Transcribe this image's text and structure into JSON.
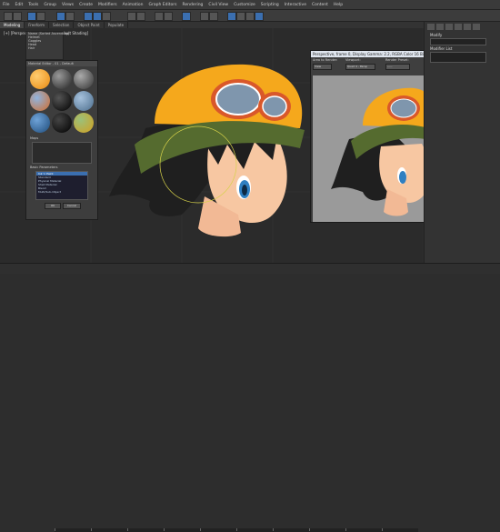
{
  "menubar": {
    "items": [
      "File",
      "Edit",
      "Tools",
      "Group",
      "Views",
      "Create",
      "Modifiers",
      "Animation",
      "Graph Editors",
      "Rendering",
      "Civil View",
      "Customize",
      "Scripting",
      "Interactive",
      "Content",
      "Help"
    ]
  },
  "tabs": [
    {
      "label": "Modeling",
      "active": true
    },
    {
      "label": "Freeform"
    },
    {
      "label": "Selection"
    },
    {
      "label": "Object Paint"
    },
    {
      "label": "Populate"
    }
  ],
  "viewport": {
    "label": "[+] [Perspective] [Standard] [Default Shading]"
  },
  "explorer": {
    "rows": [
      "Name (Sorted Ascending)",
      "Helmet",
      "Goggles",
      "Head",
      "Hair"
    ]
  },
  "material_editor": {
    "title": "Material Editor - 01 - Default",
    "section_maps": "Maps",
    "section_params": "Basic Parameters",
    "list_items": [
      "Ink 'n Paint",
      "Standard",
      "Physical Material",
      "Shell Material",
      "Blend",
      "Multi/Sub-Object",
      "Double Sided"
    ],
    "selected_index": 0,
    "ok_label": "OK",
    "cancel_label": "Cancel"
  },
  "render_window": {
    "title": "Perspective, frame 0, Display Gamma: 2.2, RGBA Color 16 Bits/Channel (1:1)",
    "area_label": "Area to Render:",
    "area_value": "View",
    "viewport_label": "Viewport:",
    "viewport_value": "Quad 4 - Persp",
    "preset_label": "Render Preset:",
    "preset_value": "-----"
  },
  "cmdpanel": {
    "label1": "Modify",
    "label2": "Modifier List"
  },
  "colors": {
    "helmet": "#f5a81c",
    "band": "#556b2f",
    "hair": "#1f1f1f",
    "skin": "#f7c7a2",
    "goggle_lens": "#7f96ad",
    "render_bg": "#9a9a9a"
  }
}
